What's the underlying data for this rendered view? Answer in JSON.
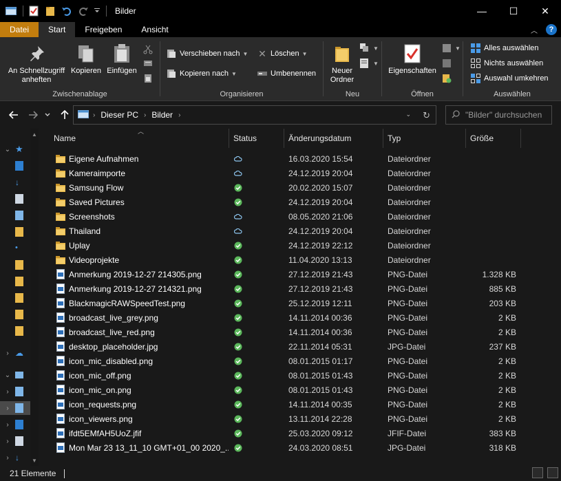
{
  "window": {
    "title": "Bilder",
    "minimize": "—",
    "maximize": "☐",
    "close": "✕"
  },
  "tabs": [
    {
      "label": "Datei"
    },
    {
      "label": "Start"
    },
    {
      "label": "Freigeben"
    },
    {
      "label": "Ansicht"
    }
  ],
  "ribbon": {
    "clipboard": {
      "pin_label_1": "An Schnellzugriff",
      "pin_label_2": "anheften",
      "copy": "Kopieren",
      "paste": "Einfügen",
      "group": "Zwischenablage"
    },
    "organize": {
      "move": "Verschieben nach",
      "copyto": "Kopieren nach",
      "delete": "Löschen",
      "rename": "Umbenennen",
      "group": "Organisieren"
    },
    "new": {
      "folder_1": "Neuer",
      "folder_2": "Ordner",
      "group": "Neu"
    },
    "open": {
      "properties": "Eigenschaften",
      "group": "Öffnen"
    },
    "select": {
      "all": "Alles auswählen",
      "none": "Nichts auswählen",
      "invert": "Auswahl umkehren",
      "group": "Auswählen"
    }
  },
  "address": {
    "segments": [
      "Dieser PC",
      "Bilder"
    ],
    "search_placeholder": "\"Bilder\" durchsuchen"
  },
  "columns": {
    "name": "Name",
    "status": "Status",
    "date": "Änderungsdatum",
    "type": "Typ",
    "size": "Größe"
  },
  "files": [
    {
      "name": "Eigene Aufnahmen",
      "status": "cloud",
      "date": "16.03.2020 15:54",
      "type": "Dateiordner",
      "size": "",
      "kind": "folder"
    },
    {
      "name": "Kameraimporte",
      "status": "cloud",
      "date": "24.12.2019 20:04",
      "type": "Dateiordner",
      "size": "",
      "kind": "folder"
    },
    {
      "name": "Samsung Flow",
      "status": "ok",
      "date": "20.02.2020 15:07",
      "type": "Dateiordner",
      "size": "",
      "kind": "folder"
    },
    {
      "name": "Saved Pictures",
      "status": "ok",
      "date": "24.12.2019 20:04",
      "type": "Dateiordner",
      "size": "",
      "kind": "folder"
    },
    {
      "name": "Screenshots",
      "status": "cloud",
      "date": "08.05.2020 21:06",
      "type": "Dateiordner",
      "size": "",
      "kind": "folder"
    },
    {
      "name": "Thailand",
      "status": "cloud",
      "date": "24.12.2019 20:04",
      "type": "Dateiordner",
      "size": "",
      "kind": "folder"
    },
    {
      "name": "Uplay",
      "status": "ok",
      "date": "24.12.2019 22:12",
      "type": "Dateiordner",
      "size": "",
      "kind": "folder"
    },
    {
      "name": "Videoprojekte",
      "status": "ok",
      "date": "11.04.2020 13:13",
      "type": "Dateiordner",
      "size": "",
      "kind": "folder"
    },
    {
      "name": "Anmerkung 2019-12-27 214305.png",
      "status": "ok",
      "date": "27.12.2019 21:43",
      "type": "PNG-Datei",
      "size": "1.328 KB",
      "kind": "image"
    },
    {
      "name": "Anmerkung 2019-12-27 214321.png",
      "status": "ok",
      "date": "27.12.2019 21:43",
      "type": "PNG-Datei",
      "size": "885 KB",
      "kind": "image"
    },
    {
      "name": "BlackmagicRAWSpeedTest.png",
      "status": "ok",
      "date": "25.12.2019 12:11",
      "type": "PNG-Datei",
      "size": "203 KB",
      "kind": "image"
    },
    {
      "name": "broadcast_live_grey.png",
      "status": "ok",
      "date": "14.11.2014 00:36",
      "type": "PNG-Datei",
      "size": "2 KB",
      "kind": "image"
    },
    {
      "name": "broadcast_live_red.png",
      "status": "ok",
      "date": "14.11.2014 00:36",
      "type": "PNG-Datei",
      "size": "2 KB",
      "kind": "image"
    },
    {
      "name": "desktop_placeholder.jpg",
      "status": "ok",
      "date": "22.11.2014 05:31",
      "type": "JPG-Datei",
      "size": "237 KB",
      "kind": "image"
    },
    {
      "name": "icon_mic_disabled.png",
      "status": "ok",
      "date": "08.01.2015 01:17",
      "type": "PNG-Datei",
      "size": "2 KB",
      "kind": "image"
    },
    {
      "name": "icon_mic_off.png",
      "status": "ok",
      "date": "08.01.2015 01:43",
      "type": "PNG-Datei",
      "size": "2 KB",
      "kind": "image"
    },
    {
      "name": "icon_mic_on.png",
      "status": "ok",
      "date": "08.01.2015 01:43",
      "type": "PNG-Datei",
      "size": "2 KB",
      "kind": "image"
    },
    {
      "name": "icon_requests.png",
      "status": "ok",
      "date": "14.11.2014 00:35",
      "type": "PNG-Datei",
      "size": "2 KB",
      "kind": "image"
    },
    {
      "name": "icon_viewers.png",
      "status": "ok",
      "date": "13.11.2014 22:28",
      "type": "PNG-Datei",
      "size": "2 KB",
      "kind": "image"
    },
    {
      "name": "ifdt5EMfAH5UoZ.jfif",
      "status": "ok",
      "date": "25.03.2020 09:12",
      "type": "JFIF-Datei",
      "size": "383 KB",
      "kind": "image"
    },
    {
      "name": "Mon Mar 23 13_11_10 GMT+01_00 2020_...",
      "status": "ok",
      "date": "24.03.2020 08:51",
      "type": "JPG-Datei",
      "size": "318 KB",
      "kind": "image"
    }
  ],
  "statusbar": {
    "count": "21 Elemente"
  },
  "colors": {
    "accent_file_tab": "#c27d0e",
    "folder": "#e8b84a",
    "ok": "#5cb85c",
    "cloud": "#8ec6f0"
  }
}
